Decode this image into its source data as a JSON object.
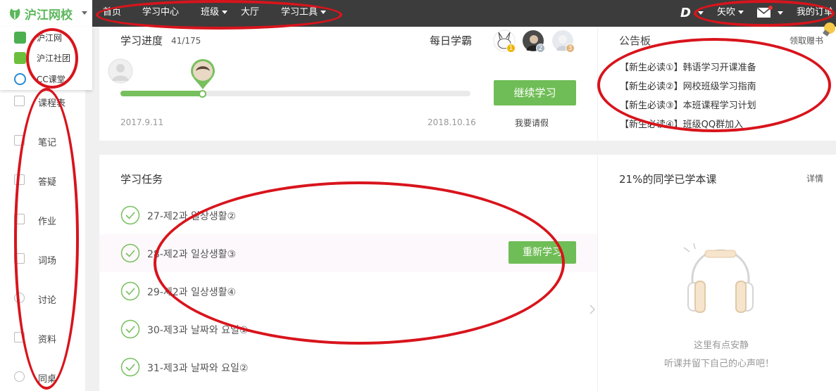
{
  "header": {
    "logo_text": "沪江网校",
    "nav": [
      "首页",
      "学习中心",
      "班级",
      "大厅",
      "学习工具"
    ],
    "user_name": "矢吹",
    "my_orders": "我的订单"
  },
  "logo_dropdown": [
    "沪江网",
    "沪江社团",
    "CC课堂"
  ],
  "sidebar": [
    "课程表",
    "笔记",
    "答疑",
    "作业",
    "词场",
    "讨论",
    "资料",
    "同桌"
  ],
  "progress": {
    "title": "学习进度",
    "count": "41/175",
    "ratio": 0.234,
    "start_date": "2017.9.11",
    "end_date": "2018.10.16",
    "top_learners_label": "每日学霸",
    "ranks": [
      "1",
      "2",
      "3"
    ],
    "continue_button": "继续学习",
    "leave_link": "我要请假"
  },
  "notice_board": {
    "title": "公告板",
    "action": "领取赠书",
    "items": [
      "【新生必读①】韩语学习开课准备",
      "【新生必读②】网校班级学习指南",
      "【新生必读③】本班课程学习计划",
      "【新生必读④】班级QQ群加入"
    ]
  },
  "tasks": {
    "title": "学习任务",
    "relearn_button": "重新学习",
    "items": [
      "27-제2과 일상생활②",
      "28-제2과 일상생활③",
      "29-제2과 일상생활④",
      "30-제3과 날짜와 요일①",
      "31-제3과 날짜와 요일②"
    ]
  },
  "classmates": {
    "title": "21%的同学已学本课",
    "details": "详情",
    "empty_line1": "这里有点安静",
    "empty_line2": "听课并留下自己的心声吧！"
  },
  "colors": {
    "brand_green": "#6fbd56",
    "topbar": "#3c3c3c",
    "annotation_red": "#d8141c"
  }
}
